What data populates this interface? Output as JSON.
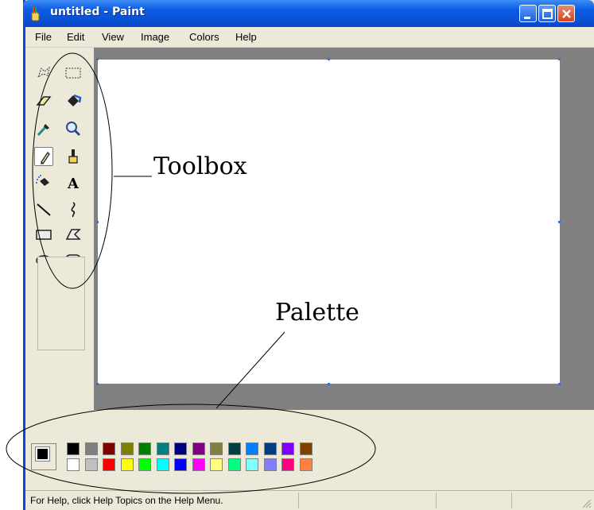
{
  "window": {
    "title": "untitled - Paint",
    "controls": [
      "minimize",
      "maximize",
      "close"
    ]
  },
  "menu": {
    "items": [
      "File",
      "Edit",
      "View",
      "Image",
      "Colors",
      "Help"
    ]
  },
  "toolbox": {
    "tools": [
      {
        "name": "free-form-select-icon"
      },
      {
        "name": "rectangle-select-icon"
      },
      {
        "name": "eraser-icon"
      },
      {
        "name": "fill-bucket-icon"
      },
      {
        "name": "pick-color-icon"
      },
      {
        "name": "magnifier-icon"
      },
      {
        "name": "pencil-icon",
        "selected": true
      },
      {
        "name": "brush-icon"
      },
      {
        "name": "airbrush-icon"
      },
      {
        "name": "text-icon",
        "glyph": "A"
      },
      {
        "name": "line-icon"
      },
      {
        "name": "curve-icon"
      },
      {
        "name": "rectangle-icon"
      },
      {
        "name": "polygon-icon"
      },
      {
        "name": "ellipse-icon"
      },
      {
        "name": "rounded-rectangle-icon"
      }
    ]
  },
  "palette": {
    "foreground": "#000000",
    "background": "#ffffff",
    "row1": [
      "#000000",
      "#808080",
      "#800000",
      "#808000",
      "#008000",
      "#008080",
      "#000080",
      "#800080",
      "#808040",
      "#004040",
      "#0080ff",
      "#004080",
      "#8000ff",
      "#804000"
    ],
    "row2": [
      "#ffffff",
      "#c0c0c0",
      "#ff0000",
      "#ffff00",
      "#00ff00",
      "#00ffff",
      "#0000ff",
      "#ff00ff",
      "#ffff80",
      "#00ff80",
      "#80ffff",
      "#8080ff",
      "#ff0080",
      "#ff8040"
    ]
  },
  "status": {
    "text": "For Help, click Help Topics on the Help Menu."
  },
  "annotations": {
    "toolbox_label": "Toolbox",
    "palette_label": "Palette"
  }
}
